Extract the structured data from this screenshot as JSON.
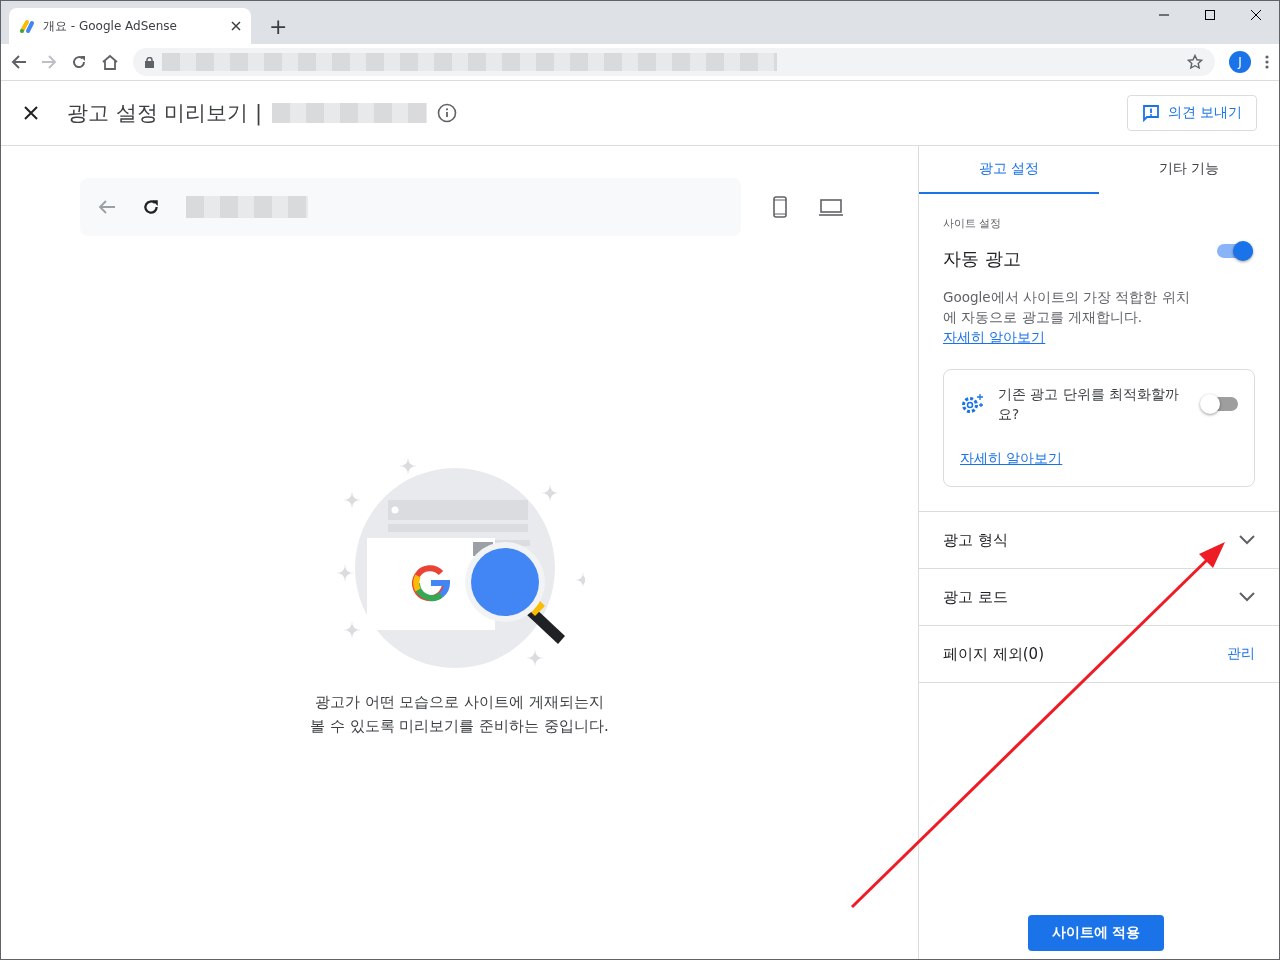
{
  "browser": {
    "tab_title": "개요 - Google AdSense",
    "new_tab": "+",
    "avatar": "J"
  },
  "header": {
    "title": "광고 설정 미리보기 |",
    "feedback_button": "의견 보내기"
  },
  "preview": {
    "message_lines": [
      "광고가 어떤 모습으로 사이트에 게재되는지",
      "볼 수 있도록 미리보기를 준비하는 중입니다."
    ]
  },
  "panel": {
    "tabs": [
      {
        "label": "광고 설정",
        "selected": true
      },
      {
        "label": "기타 기능",
        "selected": false
      }
    ],
    "section_label": "사이트 설정",
    "auto_ads": {
      "title": "자동 광고",
      "on": true,
      "description": "Google에서 사이트의 가장 적합한 위치에 자동으로 광고를 게재합니다.",
      "link": "자세히 알아보기"
    },
    "optimize_card": {
      "text": "기존 광고 단위를 최적화할까요?",
      "on": false,
      "link": "자세히 알아보기"
    },
    "rows": [
      {
        "kind": "expand",
        "label": "광고 형식"
      },
      {
        "kind": "expand",
        "label": "광고 로드"
      },
      {
        "kind": "action",
        "label": "페이지 제외(0)",
        "action": "관리"
      }
    ],
    "apply_button": "사이트에 적용"
  }
}
